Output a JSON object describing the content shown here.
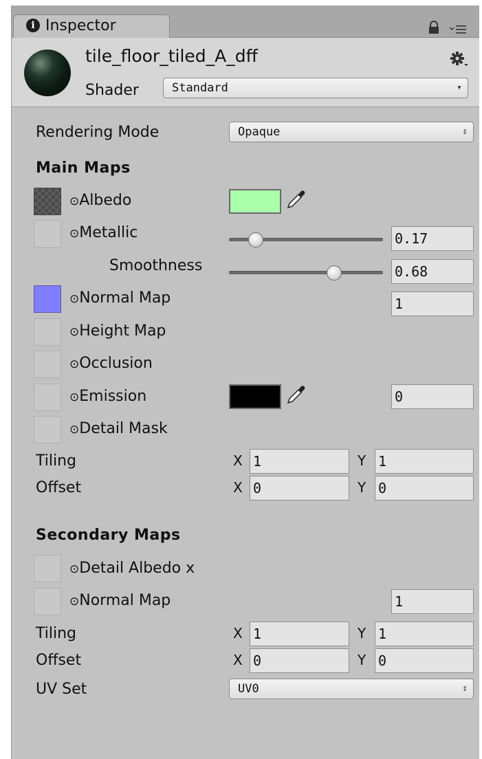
{
  "tab": {
    "title": "Inspector",
    "icon": "info-icon"
  },
  "header": {
    "material_name": "tile_floor_tiled_A_dff",
    "shader_label": "Shader",
    "shader_value": "Standard"
  },
  "rendering_mode": {
    "label": "Rendering Mode",
    "value": "Opaque"
  },
  "main_maps": {
    "title": "Main Maps",
    "albedo": {
      "label": "Albedo",
      "color": "#aaffaa"
    },
    "metallic": {
      "label": "Metallic",
      "value": "0.17",
      "fraction": 0.17
    },
    "smoothness": {
      "label": "Smoothness",
      "value": "0.68",
      "fraction": 0.68
    },
    "normal_map": {
      "label": "Normal Map",
      "value": "1",
      "slot_color": "#7f7fff"
    },
    "height_map": {
      "label": "Height Map"
    },
    "occlusion": {
      "label": "Occlusion"
    },
    "emission": {
      "label": "Emission",
      "value": "0",
      "color": "#000000"
    },
    "detail_mask": {
      "label": "Detail Mask"
    },
    "tiling": {
      "label": "Tiling",
      "x_label": "X",
      "x": "1",
      "y_label": "Y",
      "y": "1"
    },
    "offset": {
      "label": "Offset",
      "x_label": "X",
      "x": "0",
      "y_label": "Y",
      "y": "0"
    }
  },
  "secondary_maps": {
    "title": "Secondary Maps",
    "detail_albedo": {
      "label": "Detail Albedo x"
    },
    "normal_map": {
      "label": "Normal Map",
      "value": "1"
    },
    "tiling": {
      "label": "Tiling",
      "x_label": "X",
      "x": "1",
      "y_label": "Y",
      "y": "1"
    },
    "offset": {
      "label": "Offset",
      "x_label": "X",
      "x": "0",
      "y_label": "Y",
      "y": "0"
    },
    "uv_set": {
      "label": "UV Set",
      "value": "UV0"
    }
  },
  "picker_glyph": "⊙",
  "colors": {
    "panel": "#c2c2c2",
    "header": "#d6d6d6",
    "field": "#e4e4e4"
  }
}
